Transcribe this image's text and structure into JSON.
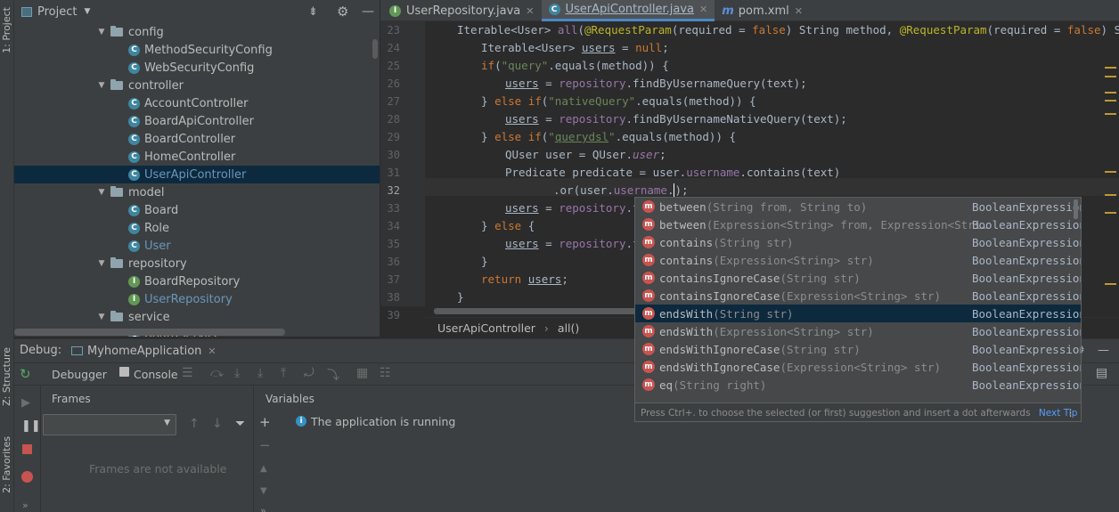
{
  "left_stripe": {
    "project": "1: Project",
    "structure": "Z: Structure",
    "favorites": "2: Favorites"
  },
  "project": {
    "title": "Project",
    "tree": [
      {
        "label": "config",
        "type": "folder",
        "expanded": true
      },
      {
        "label": "MethodSecurityConfig",
        "type": "class"
      },
      {
        "label": "WebSecurityConfig",
        "type": "class"
      },
      {
        "label": "controller",
        "type": "folder",
        "expanded": true
      },
      {
        "label": "AccountController",
        "type": "class"
      },
      {
        "label": "BoardApiController",
        "type": "class"
      },
      {
        "label": "BoardController",
        "type": "class"
      },
      {
        "label": "HomeController",
        "type": "class"
      },
      {
        "label": "UserApiController",
        "type": "class",
        "selected": true
      },
      {
        "label": "model",
        "type": "folder",
        "expanded": true
      },
      {
        "label": "Board",
        "type": "class"
      },
      {
        "label": "Role",
        "type": "class"
      },
      {
        "label": "User",
        "type": "class"
      },
      {
        "label": "repository",
        "type": "folder",
        "expanded": true
      },
      {
        "label": "BoardRepository",
        "type": "interface"
      },
      {
        "label": "UserRepository",
        "type": "interface"
      },
      {
        "label": "service",
        "type": "folder",
        "expanded": true
      },
      {
        "label": "BoardService",
        "type": "class"
      }
    ]
  },
  "tabs": [
    {
      "label": "UserRepository.java",
      "icon": "interface-icon",
      "active": false
    },
    {
      "label": "UserApiController.java",
      "icon": "class-icon",
      "active": true
    },
    {
      "label": "pom.xml",
      "icon": "maven-icon",
      "active": false
    }
  ],
  "line_numbers": [
    "23",
    "24",
    "25",
    "26",
    "27",
    "28",
    "29",
    "30",
    "31",
    "32",
    "33",
    "34",
    "35",
    "36",
    "37",
    "38",
    "39"
  ],
  "current_line": "32",
  "breadcrumb": {
    "class": "UserApiController",
    "method": "all()"
  },
  "debug": {
    "label": "Debug:",
    "config": "MyhomeApplication",
    "tab_debugger": "Debugger",
    "tab_console": "Console",
    "frames_label": "Frames",
    "variables_label": "Variables",
    "running_msg": "The application is running",
    "frames_empty": "Frames are not available"
  },
  "completion": {
    "items": [
      {
        "name": "between",
        "params": "(String from, String to)",
        "type": "BooleanExpression"
      },
      {
        "name": "between",
        "params": "(Expression<String> from, Expression<Stri…",
        "type": "BooleanExpression"
      },
      {
        "name": "contains",
        "params": "(String str)",
        "type": "BooleanExpression"
      },
      {
        "name": "contains",
        "params": "(Expression<String> str)",
        "type": "BooleanExpression"
      },
      {
        "name": "containsIgnoreCase",
        "params": "(String str)",
        "type": "BooleanExpression"
      },
      {
        "name": "containsIgnoreCase",
        "params": "(Expression<String> str)",
        "type": "BooleanExpression"
      },
      {
        "name": "endsWith",
        "params": "(String str)",
        "type": "BooleanExpression",
        "selected": true
      },
      {
        "name": "endsWith",
        "params": "(Expression<String> str)",
        "type": "BooleanExpression"
      },
      {
        "name": "endsWithIgnoreCase",
        "params": "(String str)",
        "type": "BooleanExpression"
      },
      {
        "name": "endsWithIgnoreCase",
        "params": "(Expression<String> str)",
        "type": "BooleanExpression"
      },
      {
        "name": "eq",
        "params": "(String right)",
        "type": "BooleanExpression"
      }
    ],
    "footer": "Press Ctrl+. to choose the selected (or first) suggestion and insert a dot afterwards",
    "next_tip": "Next Tip"
  },
  "colors": {
    "selection": "#0d293e",
    "keyword": "#cc7832",
    "string": "#6a8759",
    "annotation": "#bbb529",
    "field": "#9876aa"
  }
}
